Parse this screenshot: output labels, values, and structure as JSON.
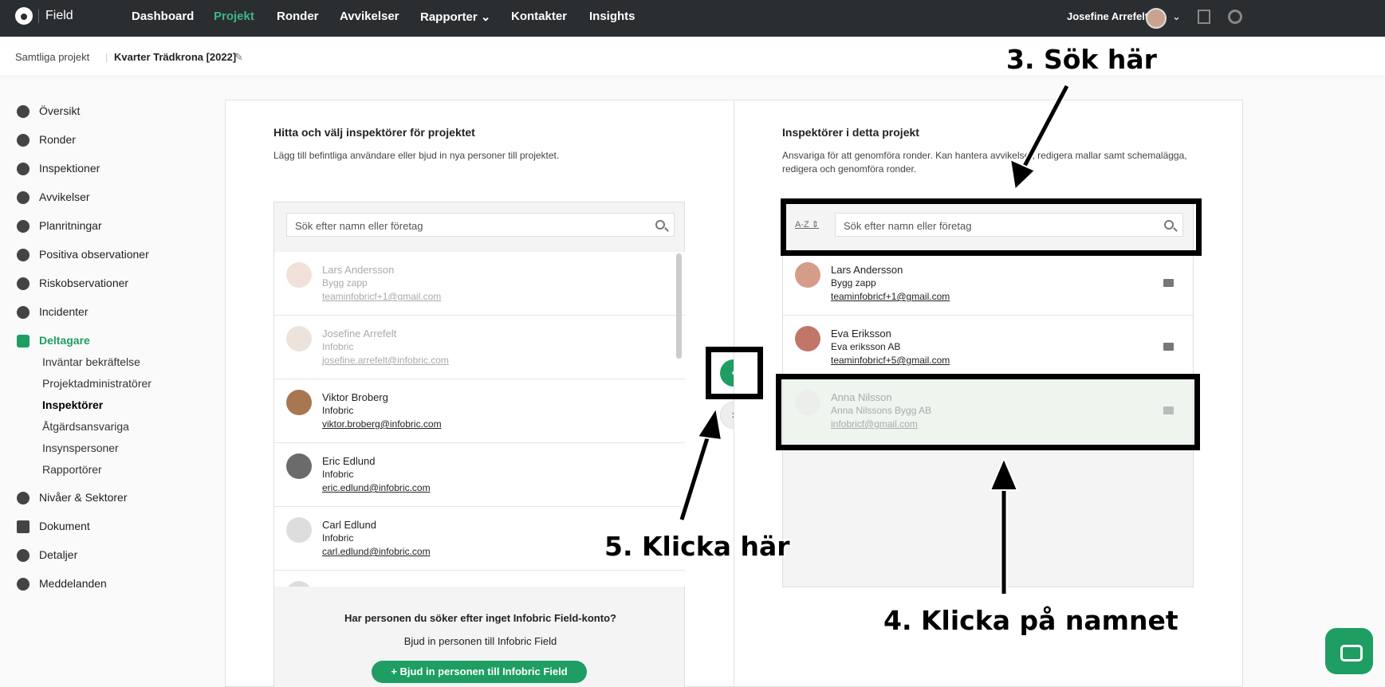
{
  "topbar": {
    "brand": "Field",
    "nav": [
      "Dashboard",
      "Projekt",
      "Ronder",
      "Avvikelser",
      "Rapporter",
      "Kontakter",
      "Insights"
    ],
    "user_name": "Josefine Arrefelt"
  },
  "breadcrumb": {
    "all_projects": "Samtliga projekt",
    "project": "Kvarter Trädkrona [2022]"
  },
  "sidebar": {
    "items": [
      "Översikt",
      "Ronder",
      "Inspektioner",
      "Avvikelser",
      "Planritningar",
      "Positiva observationer",
      "Riskobservationer",
      "Incidenter",
      "Deltagare",
      "Nivåer & Sektorer",
      "Dokument",
      "Detaljer",
      "Meddelanden"
    ],
    "sub": [
      "Inväntar bekräftelse",
      "Projektadministratörer",
      "Inspektörer",
      "Åtgärdsansvariga",
      "Insynspersoner",
      "Rapportörer"
    ]
  },
  "left": {
    "title": "Hitta och välj inspektörer för projektet",
    "subtitle": "Lägg till befintliga användare eller bjud in nya personer till projektet.",
    "search_placeholder": "Sök efter namn eller företag",
    "people": [
      {
        "name": "Lars Andersson",
        "company": "Bygg zapp",
        "email": "teaminfobricf+1@gmail.com"
      },
      {
        "name": "Josefine Arrefelt",
        "company": "Infobric",
        "email": "josefine.arrefelt@infobric.com"
      },
      {
        "name": "Viktor Broberg",
        "company": "Infobric",
        "email": "viktor.broberg@infobric.com"
      },
      {
        "name": "Eric Edlund",
        "company": "Infobric",
        "email": "eric.edlund@infobric.com"
      },
      {
        "name": "Carl Edlund",
        "company": "Infobric",
        "email": "carl.edlund@infobric.com"
      }
    ],
    "no_account_title": "Har personen du söker efter inget Infobric Field-konto?",
    "no_account_sub": "Bjud in personen till Infobric Field",
    "invite_button": "+ Bjud in personen till Infobric Field"
  },
  "right": {
    "title": "Inspektörer i detta projekt",
    "subtitle_1": "Ansvariga för att genomföra ronder. Kan hantera avvikelser, redigera mallar samt schemalägga,",
    "subtitle_2": "redigera och genomföra ronder.",
    "sort": "A-Z",
    "search_placeholder": "Sök efter namn eller företag",
    "people": [
      {
        "name": "Lars Andersson",
        "company": "Bygg zapp",
        "email": "teaminfobricf+1@gmail.com"
      },
      {
        "name": "Eva Eriksson",
        "company": "Eva eriksson AB",
        "email": "teaminfobricf+5@gmail.com"
      },
      {
        "name": "Anna Nilsson",
        "company": "Anna Nilssons Bygg AB",
        "email": "infobricf@gmail.com"
      }
    ]
  },
  "annotations": {
    "a3": "3. Sök här",
    "a4": "4. Klicka på namnet",
    "a5": "5. Klicka här"
  },
  "colors": {
    "brand_green": "#1e9e63",
    "topbar": "#2b2e31"
  }
}
